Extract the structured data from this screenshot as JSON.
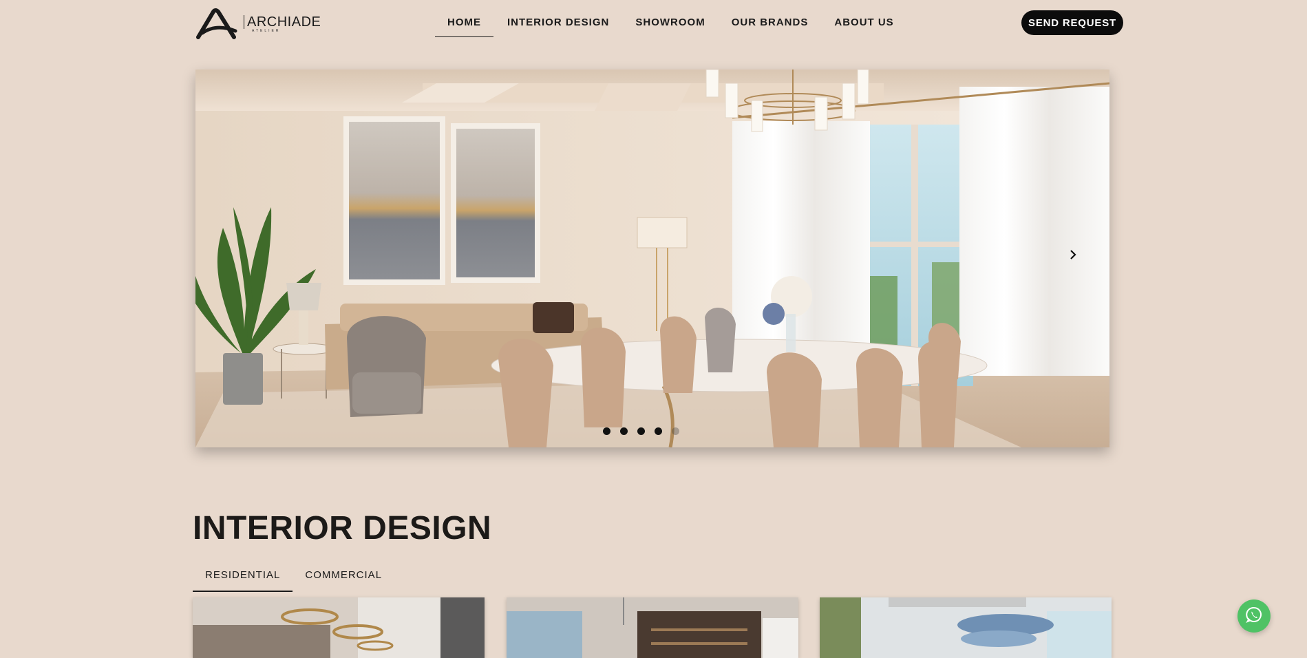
{
  "brand": {
    "name": "ARCHIADE",
    "subtitle": "ATELIER"
  },
  "nav": {
    "items": [
      {
        "label": "HOME",
        "active": true
      },
      {
        "label": "INTERIOR DESIGN",
        "active": false
      },
      {
        "label": "SHOWROOM",
        "active": false
      },
      {
        "label": "OUR BRANDS",
        "active": false
      },
      {
        "label": "ABOUT US",
        "active": false
      }
    ],
    "cta_label": "SEND REQUEST"
  },
  "hero": {
    "slides_count": 5,
    "active_slide": 5,
    "next_icon": "chevron-right-icon"
  },
  "section": {
    "title": "INTERIOR DESIGN",
    "tabs": [
      {
        "label": "RESIDENTIAL",
        "active": true
      },
      {
        "label": "COMMERCIAL",
        "active": false
      }
    ],
    "cards_count": 3
  },
  "floating": {
    "whatsapp_icon": "whatsapp-icon"
  },
  "colors": {
    "page_background": "#e8d9cd",
    "button_dark": "#0c0c0c",
    "whatsapp_green": "#4fc265"
  }
}
